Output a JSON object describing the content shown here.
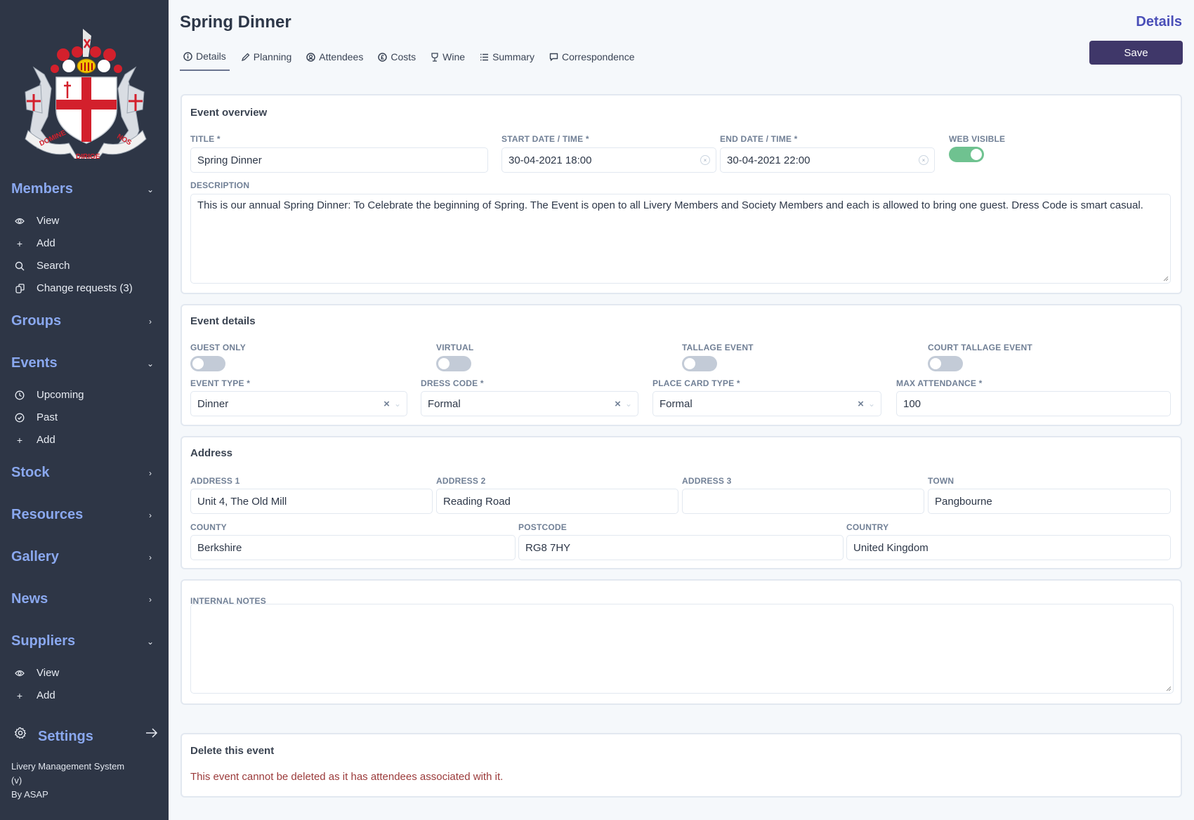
{
  "sidebar": {
    "logo_alt": "City of London coat of arms - Domine Dirige Nos",
    "sections": [
      {
        "label": "Members",
        "expanded": true,
        "items": [
          {
            "label": "View",
            "icon": "eye-icon"
          },
          {
            "label": "Add",
            "icon": "plus-icon"
          },
          {
            "label": "Search",
            "icon": "search-icon"
          },
          {
            "label": "Change requests (3)",
            "icon": "copy-icon"
          }
        ]
      },
      {
        "label": "Groups",
        "expanded": false
      },
      {
        "label": "Events",
        "expanded": true,
        "items": [
          {
            "label": "Upcoming",
            "icon": "clock-icon"
          },
          {
            "label": "Past",
            "icon": "check-circle-icon"
          },
          {
            "label": "Add",
            "icon": "plus-icon"
          }
        ]
      },
      {
        "label": "Stock",
        "expanded": false
      },
      {
        "label": "Resources",
        "expanded": false
      },
      {
        "label": "Gallery",
        "expanded": false
      },
      {
        "label": "News",
        "expanded": false
      },
      {
        "label": "Suppliers",
        "expanded": true,
        "items": [
          {
            "label": "View",
            "icon": "eye-icon"
          },
          {
            "label": "Add",
            "icon": "plus-icon"
          }
        ]
      }
    ],
    "settings_label": "Settings",
    "footer": {
      "line1": "Livery Management System",
      "line2": "(v)",
      "line3": "By ASAP"
    }
  },
  "header": {
    "title": "Spring Dinner",
    "section": "Details",
    "save_label": "Save",
    "tabs": [
      {
        "label": "Details",
        "icon": "info-icon",
        "active": true
      },
      {
        "label": "Planning",
        "icon": "pencil-icon"
      },
      {
        "label": "Attendees",
        "icon": "user-circle-icon"
      },
      {
        "label": "Costs",
        "icon": "pound-icon"
      },
      {
        "label": "Wine",
        "icon": "wine-glass-icon"
      },
      {
        "label": "Summary",
        "icon": "list-icon"
      },
      {
        "label": "Correspondence",
        "icon": "chat-icon"
      }
    ]
  },
  "overview": {
    "heading": "Event overview",
    "title_label": "TITLE *",
    "title_value": "Spring Dinner",
    "start_label": "START DATE / TIME *",
    "start_value": "30-04-2021 18:00",
    "end_label": "END DATE / TIME *",
    "end_value": "30-04-2021 22:00",
    "web_visible_label": "WEB VISIBLE",
    "web_visible": true,
    "description_label": "DESCRIPTION",
    "description_value": "This is our annual Spring Dinner: To Celebrate  the beginning of Spring. The Event is open to all Livery Members and Society Members and each is allowed to bring one guest. Dress Code is smart casual."
  },
  "details": {
    "heading": "Event details",
    "guest_only_label": "GUEST ONLY",
    "guest_only": false,
    "virtual_label": "VIRTUAL",
    "virtual": false,
    "tallage_label": "TALLAGE EVENT",
    "tallage": false,
    "court_tallage_label": "COURT TALLAGE EVENT",
    "court_tallage": false,
    "event_type_label": "EVENT TYPE *",
    "event_type_value": "Dinner",
    "dress_code_label": "DRESS CODE *",
    "dress_code_value": "Formal",
    "place_card_label": "PLACE CARD TYPE *",
    "place_card_value": "Formal",
    "max_attendance_label": "MAX ATTENDANCE *",
    "max_attendance_value": "100"
  },
  "address": {
    "heading": "Address",
    "address1_label": "ADDRESS 1",
    "address1_value": "Unit 4, The Old Mill",
    "address2_label": "ADDRESS 2",
    "address2_value": "Reading Road",
    "address3_label": "ADDRESS 3",
    "address3_value": "",
    "town_label": "TOWN",
    "town_value": "Pangbourne",
    "county_label": "COUNTY",
    "county_value": "Berkshire",
    "postcode_label": "POSTCODE",
    "postcode_value": "RG8 7HY",
    "country_label": "COUNTRY",
    "country_value": "United Kingdom"
  },
  "notes": {
    "label": "INTERNAL NOTES",
    "value": ""
  },
  "delete": {
    "heading": "Delete this event",
    "message": "This event cannot be deleted as it has attendees associated with it."
  },
  "colors": {
    "sidebar_bg": "#2e3646",
    "sidebar_heading": "#8aa8ef",
    "accent": "#3f3769",
    "toggle_on": "#6fc290",
    "error": "#9b3a3a"
  }
}
